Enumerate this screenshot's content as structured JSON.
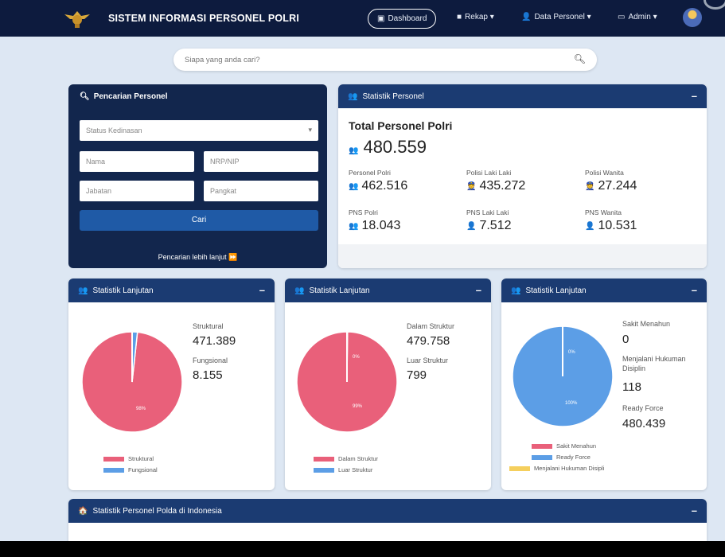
{
  "navbar": {
    "brand": "SISTEM INFORMASI PERSONEL POLRI",
    "items": [
      {
        "label": "Dashboard",
        "icon": "dashboard-icon"
      },
      {
        "label": "Rekap ▾",
        "icon": "file-icon"
      },
      {
        "label": "Data Personel ▾",
        "icon": "user-icon"
      },
      {
        "label": "Admin ▾",
        "icon": "monitor-icon"
      }
    ]
  },
  "search": {
    "placeholder": "Siapa yang anda cari?"
  },
  "pencarian": {
    "title": "Pencarian Personel",
    "status_placeholder": "Status Kedinasan",
    "nama_placeholder": "Nama",
    "nrp_placeholder": "NRP/NIP",
    "jabatan_placeholder": "Jabatan",
    "pangkat_placeholder": "Pangkat",
    "cari_label": "Cari",
    "lanjut_label": "Pencarian lebih lanjut ⏩"
  },
  "statistik": {
    "title": "Statistik Personel",
    "total_label": "Total Personel Polri",
    "total_value": "480.559",
    "items": [
      {
        "label": "Personel Polri",
        "value": "462.516"
      },
      {
        "label": "Polisi Laki Laki",
        "value": "435.272"
      },
      {
        "label": "Polisi Wanita",
        "value": "27.244"
      },
      {
        "label": "PNS Polri",
        "value": "18.043"
      },
      {
        "label": "PNS Laki Laki",
        "value": "7.512"
      },
      {
        "label": "PNS Wanita",
        "value": "10.531"
      }
    ]
  },
  "lanjutan_1": {
    "title": "Statistik Lanjutan",
    "labels": [
      "Struktural",
      "Fungsional"
    ],
    "values": [
      "471.389",
      "8.155"
    ],
    "legend": [
      "Struktural",
      "Fungsional"
    ],
    "center_pct": "98%"
  },
  "lanjutan_2": {
    "title": "Statistik Lanjutan",
    "labels": [
      "Dalam Struktur",
      "Luar Struktur"
    ],
    "values": [
      "479.758",
      "799"
    ],
    "legend": [
      "Dalam Struktur",
      "Luar Struktur"
    ],
    "center_pct": "99%",
    "slice_pct": "0%"
  },
  "lanjutan_3": {
    "title": "Statistik Lanjutan",
    "labels": [
      "Sakit Menahun",
      "Menjalani Hukuman Disiplin",
      "Ready Force"
    ],
    "values": [
      "0",
      "118",
      "480.439"
    ],
    "legend": [
      "Sakit Menahun",
      "Ready Force",
      "Menjalani Hukuman Disipli"
    ],
    "center_pct": "100%",
    "slice_pct": "0%"
  },
  "polda": {
    "title": "Statistik Personel Polda di Indonesia"
  },
  "chart_data": [
    {
      "type": "pie",
      "categories": [
        "Struktural",
        "Fungsional"
      ],
      "values": [
        471389,
        8155
      ],
      "colors": [
        "#e9607a",
        "#5c9ee6"
      ]
    },
    {
      "type": "pie",
      "categories": [
        "Dalam Struktur",
        "Luar Struktur"
      ],
      "values": [
        479758,
        799
      ],
      "colors": [
        "#e9607a",
        "#5c9ee6"
      ]
    },
    {
      "type": "pie",
      "categories": [
        "Sakit Menahun",
        "Ready Force",
        "Menjalani Hukuman Disipli"
      ],
      "values": [
        0,
        480439,
        118
      ],
      "colors": [
        "#e9607a",
        "#5c9ee6",
        "#f5cf5d"
      ]
    }
  ],
  "colors": {
    "navy": "#0d1b3e",
    "card_header": "#1b3b72",
    "pink": "#e9607a",
    "blue": "#5c9ee6",
    "yellow": "#f5cf5d"
  }
}
